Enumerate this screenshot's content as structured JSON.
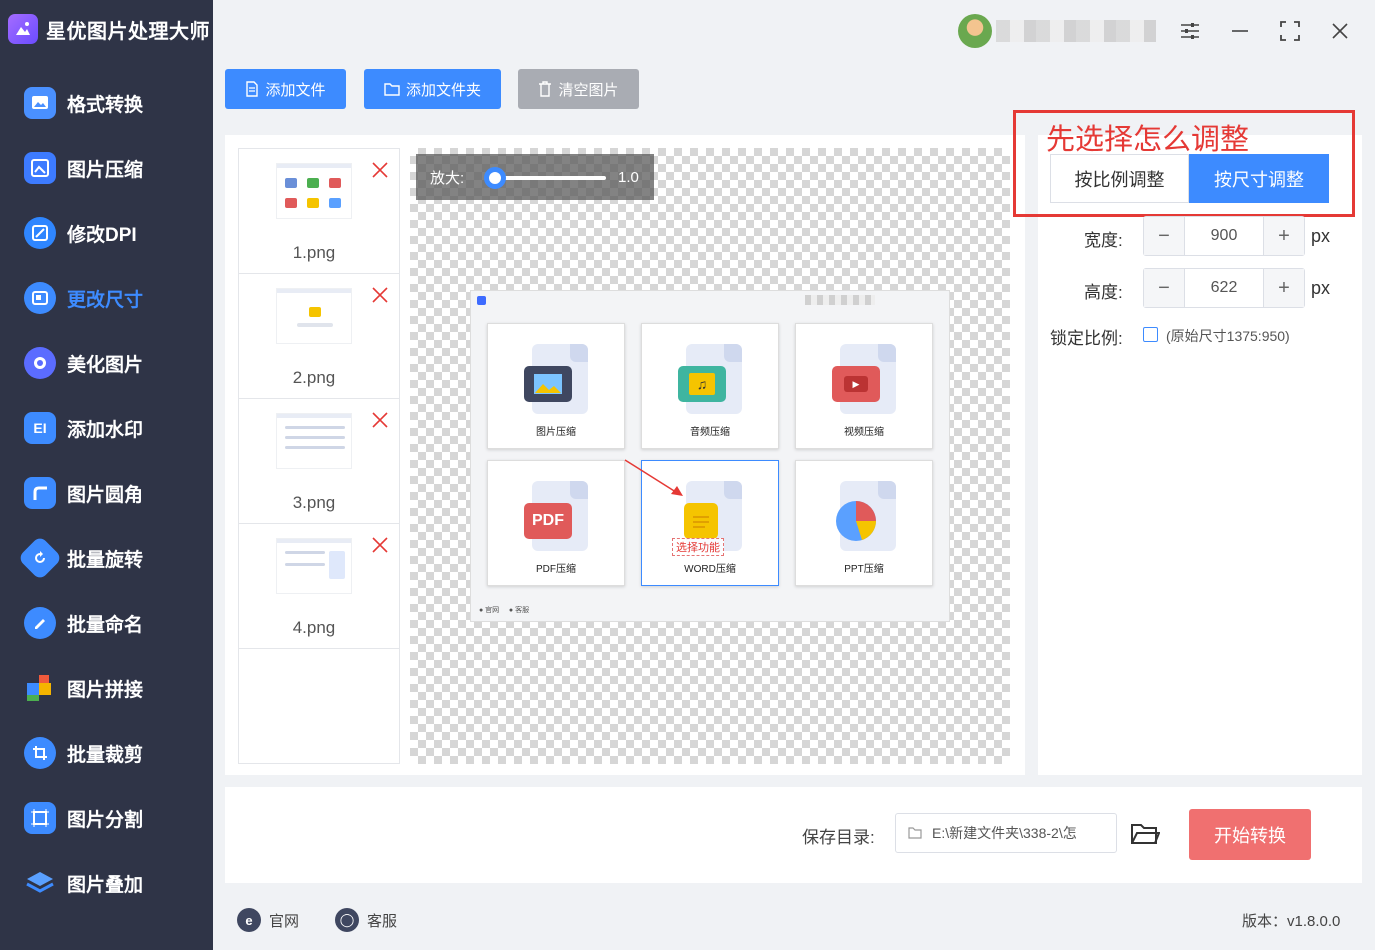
{
  "app": {
    "title": "星优图片处理大师"
  },
  "sidebar": {
    "items": [
      {
        "label": "格式转换",
        "icon": "image-convert-icon",
        "color": "#4a90ff"
      },
      {
        "label": "图片压缩",
        "icon": "image-compress-icon",
        "color": "#3d7bff"
      },
      {
        "label": "修改DPI",
        "icon": "dpi-icon",
        "color": "#2f86ff"
      },
      {
        "label": "更改尺寸",
        "icon": "resize-icon",
        "color": "#3d8bff",
        "active": true
      },
      {
        "label": "美化图片",
        "icon": "beautify-icon",
        "color": "#5b6cff"
      },
      {
        "label": "添加水印",
        "icon": "watermark-icon",
        "color": "#3d8bff"
      },
      {
        "label": "图片圆角",
        "icon": "round-corner-icon",
        "color": "#3d8bff"
      },
      {
        "label": "批量旋转",
        "icon": "rotate-icon",
        "color": "#3d8bff"
      },
      {
        "label": "批量命名",
        "icon": "rename-icon",
        "color": "#3d8bff"
      },
      {
        "label": "图片拼接",
        "icon": "puzzle-icon",
        "color": "#f05a3c"
      },
      {
        "label": "批量裁剪",
        "icon": "crop-icon",
        "color": "#3d8bff"
      },
      {
        "label": "图片分割",
        "icon": "split-icon",
        "color": "#3d8bff"
      },
      {
        "label": "图片叠加",
        "icon": "layers-icon",
        "color": "#3d8bff"
      }
    ]
  },
  "toolbar": {
    "add_file": "添加文件",
    "add_folder": "添加文件夹",
    "clear": "清空图片"
  },
  "files": [
    {
      "name": "1.png"
    },
    {
      "name": "2.png"
    },
    {
      "name": "3.png"
    },
    {
      "name": "4.png"
    }
  ],
  "preview": {
    "zoom_label": "放大:",
    "zoom_value": "1.0",
    "zoom_fraction": 0.0,
    "inner": {
      "cards": [
        "图片压缩",
        "音频压缩",
        "视频压缩",
        "PDF压缩",
        "WORD压缩",
        "PPT压缩"
      ],
      "pdf_text": "PDF",
      "annotation": "选择功能"
    }
  },
  "settings": {
    "annotation": "先选择怎么调整",
    "mode_ratio": "按比例调整",
    "mode_size": "按尺寸调整",
    "width_label": "宽度:",
    "width_value": "900",
    "height_label": "高度:",
    "height_value": "622",
    "unit": "px",
    "lock_label": "锁定比例:",
    "original_size": "(原始尺寸1375:950)",
    "lock_checked": false
  },
  "save": {
    "label": "保存目录:",
    "path": "E:\\新建文件夹\\338-2\\怎",
    "start_button": "开始转换"
  },
  "footer": {
    "website": "官网",
    "support": "客服",
    "version": "版本：v1.8.0.0"
  },
  "colors": {
    "accent": "#3d8bff",
    "sidebar_bg": "#2f3447",
    "start": "#f07070",
    "annotation": "#e53935"
  }
}
